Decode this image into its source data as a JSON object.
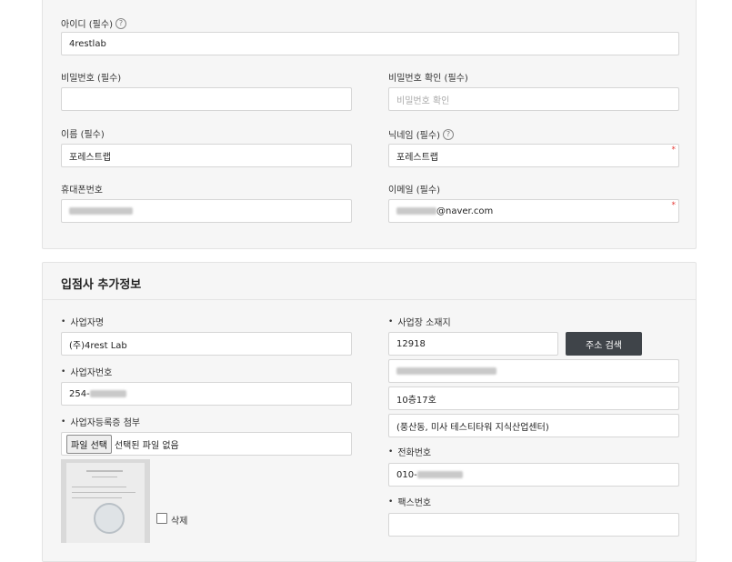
{
  "account": {
    "id_label": "아이디 (필수)",
    "id_help_icon": "question-circle-icon",
    "id_value": "4restlab",
    "password_label": "비밀번호 (필수)",
    "password_value": "",
    "password_confirm_label": "비밀번호 확인 (필수)",
    "password_confirm_placeholder": "비밀번호 확인",
    "name_label": "이름 (필수)",
    "name_value": "포레스트랩",
    "nickname_label": "닉네임 (필수)",
    "nickname_help_icon": "question-circle-icon",
    "nickname_value": "포레스트랩",
    "phone_label": "휴대폰번호",
    "email_label": "이메일 (필수)",
    "email_domain": "@naver.com",
    "required_marker": "*"
  },
  "business": {
    "section_title": "입점사 추가정보",
    "bullet": "•",
    "company_name_label": "사업자명",
    "company_name_value": "(주)4rest Lab",
    "business_number_label": "사업자번호",
    "business_number_prefix": "254-",
    "registration_doc_label": "사업자등록증 첨부",
    "file_button_label": "파일 선택",
    "file_status": "선택된 파일 없음",
    "delete_label": "삭제",
    "address_label": "사업장 소재지",
    "zipcode_value": "12918",
    "address_search_button": "주소 검색",
    "address_detail_value": "10층17호",
    "address_extra_value": "(풍산동, 미사 테스티타워 지식산업센터)",
    "tel_label": "전화번호",
    "tel_prefix": "010-",
    "fax_label": "팩스번호",
    "fax_value": ""
  }
}
